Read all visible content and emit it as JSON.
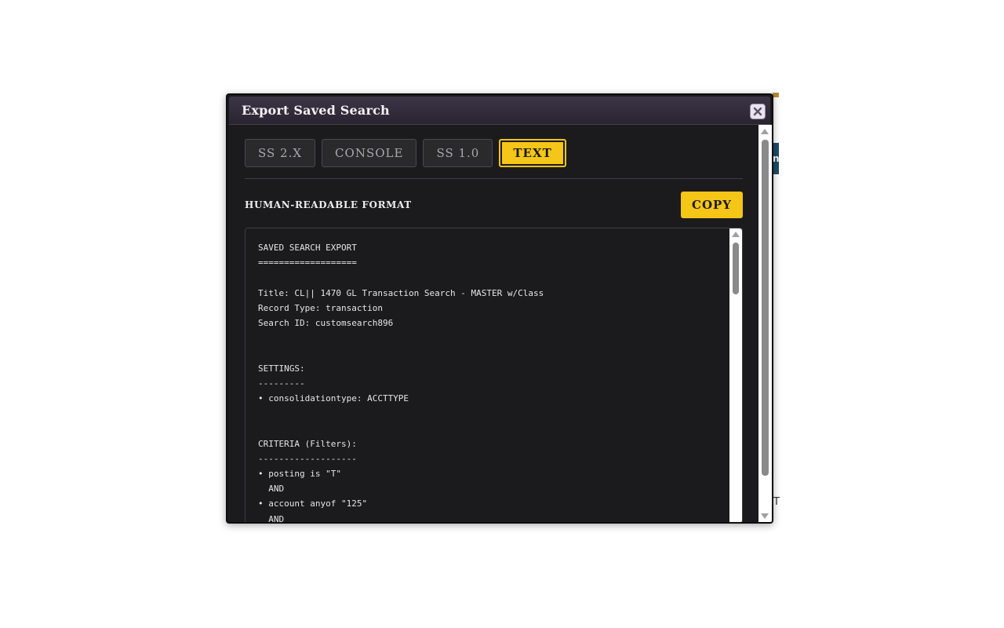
{
  "dialog": {
    "title": "Export Saved Search",
    "close_icon": "close-icon"
  },
  "tabs": [
    {
      "label": "SS 2.X",
      "active": false
    },
    {
      "label": "CONSOLE",
      "active": false
    },
    {
      "label": "SS 1.0",
      "active": false
    },
    {
      "label": "TEXT",
      "active": true
    }
  ],
  "section": {
    "label": "HUMAN-READABLE FORMAT",
    "copy_label": "COPY"
  },
  "export_text": "SAVED SEARCH EXPORT\n===================\n\nTitle: CL|| 1470 GL Transaction Search - MASTER w/Class\nRecord Type: transaction\nSearch ID: customsearch896\n\n\nSETTINGS:\n---------\n• consolidationtype: ACCTTYPE\n\n\nCRITERIA (Filters):\n-------------------\n• posting is \"T\"\n  AND\n• account anyof \"125\"\n  AND",
  "background": {
    "tab_fragment": "n",
    "text_fragment": "T"
  },
  "colors": {
    "accent": "#f5c518",
    "panel": "#1b1b1e",
    "titlebar": "#2a2431"
  }
}
